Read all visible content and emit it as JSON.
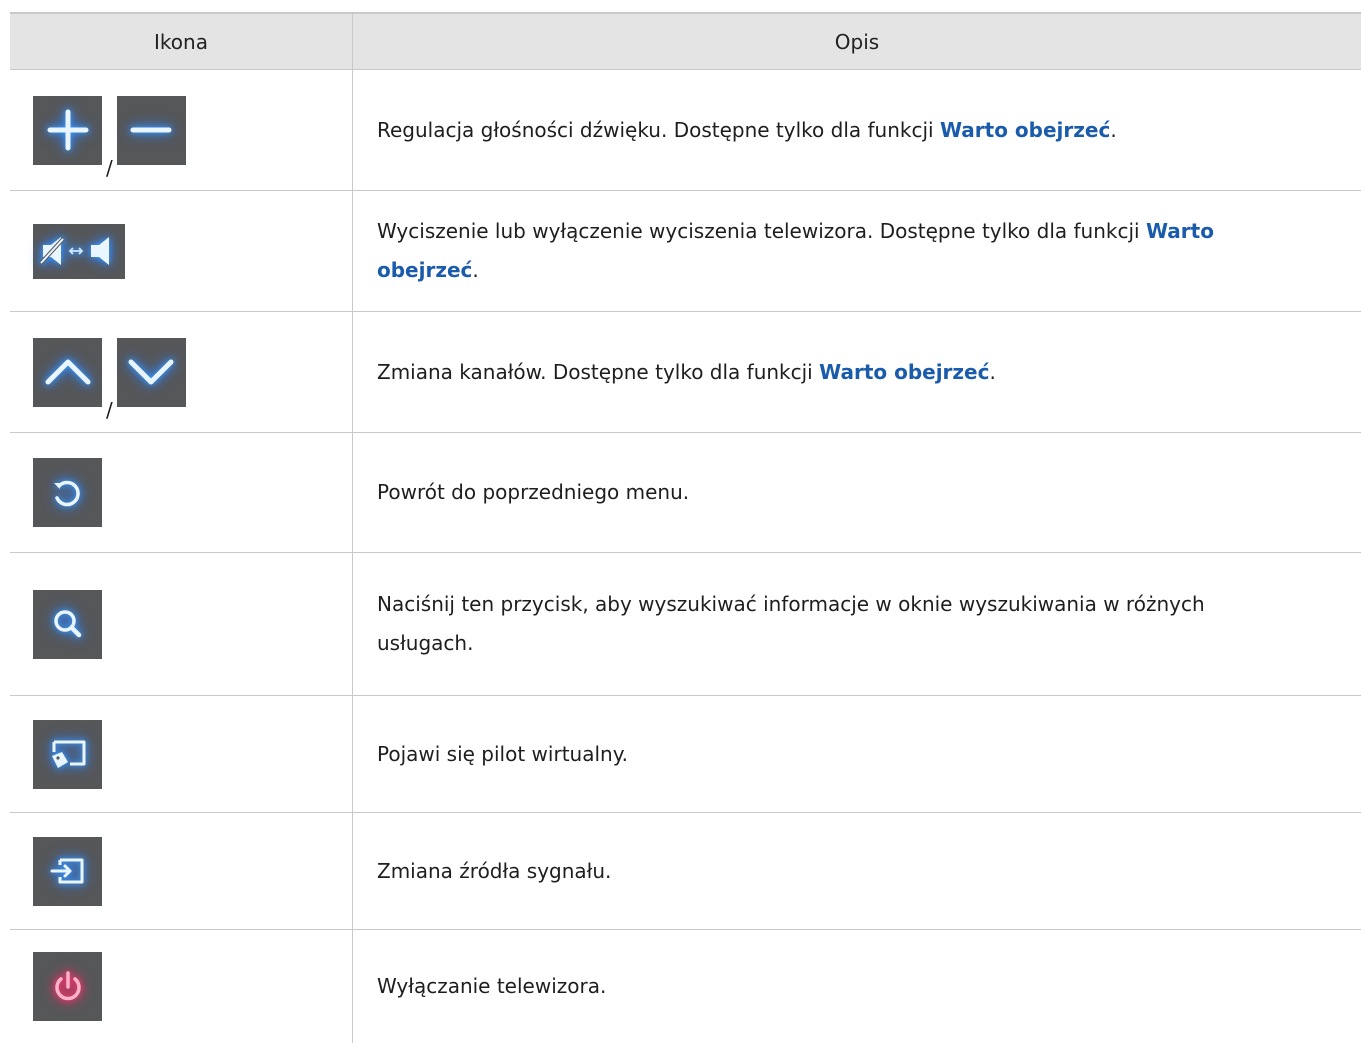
{
  "header": {
    "icon_col": "Ikona",
    "desc_col": "Opis"
  },
  "rows": [
    {
      "icons": [
        "plus-icon",
        "minus-icon"
      ],
      "separator": "/",
      "desc_before": "Regulacja głośności dźwięku. Dostępne tylko dla funkcji ",
      "highlight": "Warto obejrzeć",
      "desc_after": "."
    },
    {
      "icons": [
        "mute-toggle-icon"
      ],
      "desc_before": "Wyciszenie lub wyłączenie wyciszenia telewizora. Dostępne tylko dla funkcji ",
      "highlight": "Warto obejrzeć",
      "desc_after": "."
    },
    {
      "icons": [
        "chevron-up-icon",
        "chevron-down-icon"
      ],
      "separator": "/",
      "desc_before": "Zmiana kanałów. Dostępne tylko dla funkcji ",
      "highlight": "Warto obejrzeć",
      "desc_after": "."
    },
    {
      "icons": [
        "return-icon"
      ],
      "desc": "Powrót do poprzedniego menu."
    },
    {
      "icons": [
        "search-icon"
      ],
      "desc": "Naciśnij ten przycisk, aby wyszukiwać informacje w oknie wyszukiwania w różnych usługach."
    },
    {
      "icons": [
        "virtual-remote-icon"
      ],
      "desc": "Pojawi się pilot wirtualny."
    },
    {
      "icons": [
        "source-icon"
      ],
      "desc": "Zmiana źródła sygnału."
    },
    {
      "icons": [
        "power-icon"
      ],
      "desc": "Wyłączanie telewizora."
    }
  ],
  "colors": {
    "highlight": "#1a5bab",
    "button_bg": "#555759",
    "glow_blue": "#3aa0ff",
    "glow_red": "#ff1f5f",
    "header_bg": "#e4e4e4"
  }
}
